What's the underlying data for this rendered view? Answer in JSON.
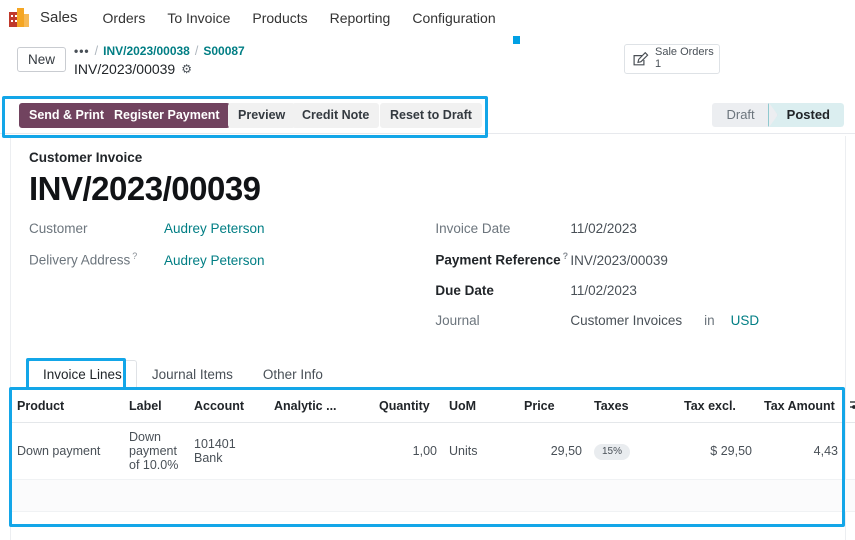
{
  "navbar": {
    "logo_icon": "sales-app-icon",
    "brand": "Sales",
    "items": [
      {
        "label": "Orders"
      },
      {
        "label": "To Invoice"
      },
      {
        "label": "Products"
      },
      {
        "label": "Reporting"
      },
      {
        "label": "Configuration"
      }
    ]
  },
  "controlpanel": {
    "new_button": "New",
    "breadcrumb": {
      "dots": "•••",
      "sep": "/",
      "parent1": "INV/2023/00038",
      "parent2": "S00087",
      "current": "INV/2023/00039",
      "gear_icon": "gear-icon"
    },
    "stat_button": {
      "icon": "pencil-square-icon",
      "label": "Sale Orders",
      "value": "1"
    }
  },
  "actions": {
    "buttons": [
      {
        "label": "Send & Print",
        "style": "primary"
      },
      {
        "label": "Register Payment",
        "style": "primary"
      },
      {
        "label": "Preview",
        "style": "secondary"
      },
      {
        "label": "Credit Note",
        "style": "secondary"
      },
      {
        "label": "Reset to Draft",
        "style": "secondary"
      }
    ],
    "primary_color": "#71435F"
  },
  "statusbar": {
    "stages": [
      {
        "label": "Draft",
        "active": false
      },
      {
        "label": "Posted",
        "active": true
      }
    ],
    "active_color": "#DBEEF0"
  },
  "record": {
    "doc_type": "Customer Invoice",
    "doc_number": "INV/2023/00039",
    "left_fields": [
      {
        "label": "Customer",
        "value": "Audrey Peterson",
        "link": true,
        "required": false,
        "help": false
      },
      {
        "label": "Delivery Address",
        "value": "Audrey Peterson",
        "link": true,
        "required": false,
        "help": true
      }
    ],
    "right_fields": [
      {
        "label": "Invoice Date",
        "value": "11/02/2023",
        "required": false,
        "help": false
      },
      {
        "label": "Payment Reference",
        "value": "INV/2023/00039",
        "required": true,
        "help": true
      },
      {
        "label": "Due Date",
        "value": "11/02/2023",
        "required": true,
        "help": false
      },
      {
        "label": "Journal",
        "value": "Customer Invoices",
        "required": false,
        "help": false,
        "extra": "in",
        "currency": "USD"
      }
    ]
  },
  "tabs": [
    {
      "label": "Invoice Lines",
      "active": true
    },
    {
      "label": "Journal Items",
      "active": false
    },
    {
      "label": "Other Info",
      "active": false
    }
  ],
  "lines_table": {
    "columns": [
      "Product",
      "Label",
      "Account",
      "Analytic ...",
      "Quantity",
      "UoM",
      "Price",
      "Taxes",
      "Tax excl.",
      "Tax Amount"
    ],
    "optional_columns_icon": "sliders-icon",
    "rows": [
      {
        "product": "Down payment",
        "label": "Down payment of 10.0%",
        "account": "101401 Bank",
        "analytic": "",
        "quantity": "1,00",
        "uom": "Units",
        "price": "29,50",
        "taxes": "15%",
        "tax_excl": "$ 29,50",
        "tax_amount": "4,43"
      }
    ]
  },
  "highlights": {
    "color": "#13A6E8",
    "regions": [
      "action-buttons",
      "invoice-lines-tab",
      "invoice-lines-table"
    ]
  },
  "marker": {
    "name": "blue-dot-marker",
    "color": "#00A0E4"
  }
}
